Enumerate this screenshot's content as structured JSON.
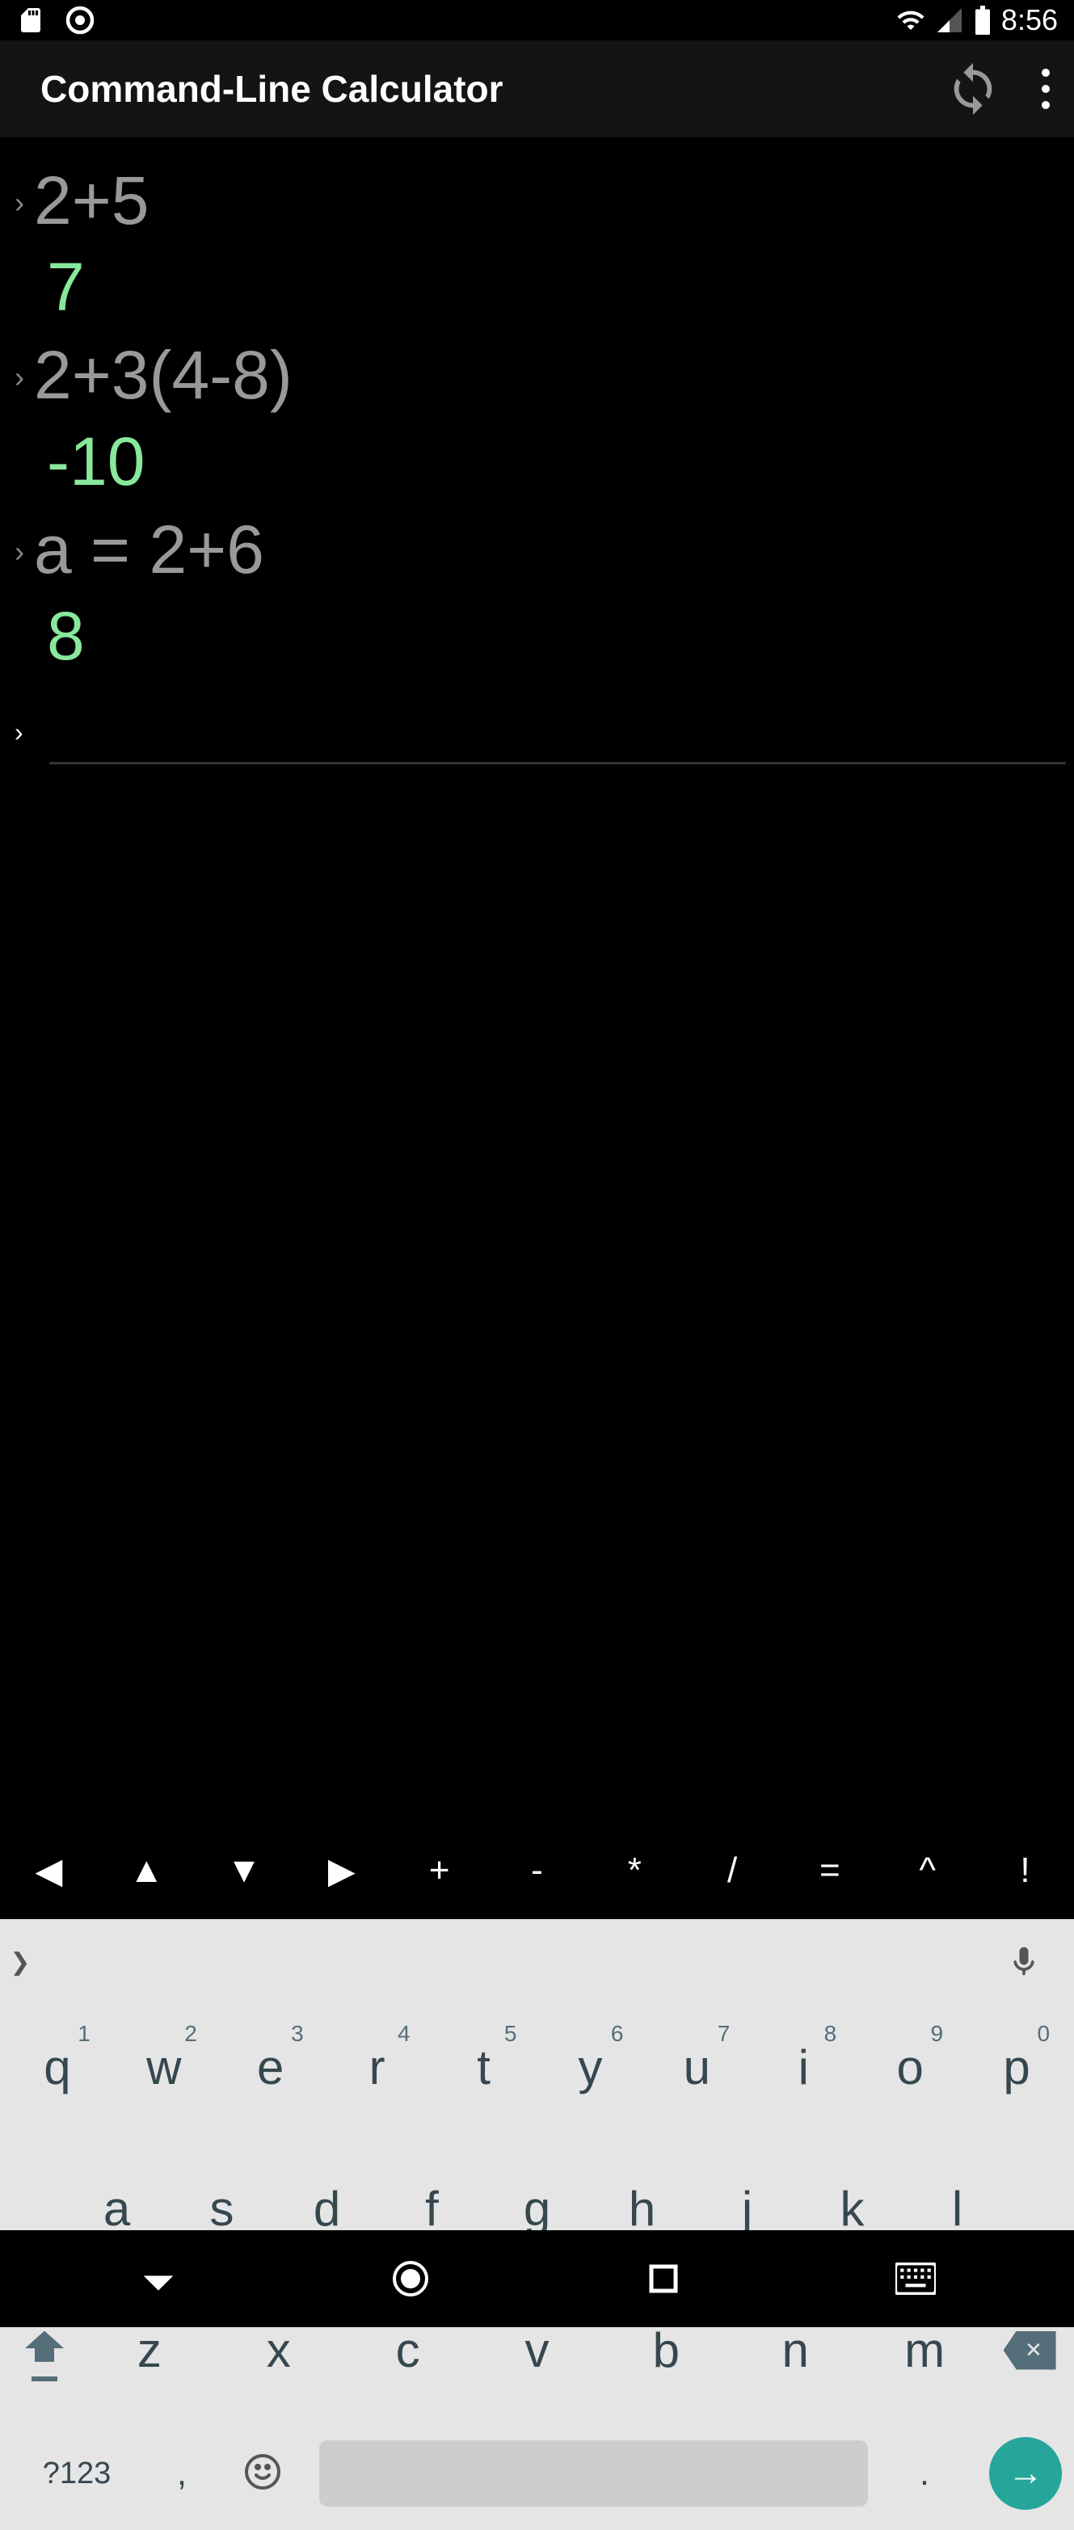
{
  "status": {
    "time": "8:56"
  },
  "app": {
    "title": "Command-Line Calculator"
  },
  "history": [
    {
      "expr": "2+5",
      "result": "7"
    },
    {
      "expr": "2+3(4-8)",
      "result": "-10"
    },
    {
      "expr": "a = 2+6",
      "result": "8"
    }
  ],
  "symbol_keys": [
    "◀",
    "▲",
    "▼",
    "▶",
    "+",
    "-",
    "*",
    "/",
    "=",
    "^",
    "!"
  ],
  "kb": {
    "row1": [
      {
        "k": "q",
        "a": "1"
      },
      {
        "k": "w",
        "a": "2"
      },
      {
        "k": "e",
        "a": "3"
      },
      {
        "k": "r",
        "a": "4"
      },
      {
        "k": "t",
        "a": "5"
      },
      {
        "k": "y",
        "a": "6"
      },
      {
        "k": "u",
        "a": "7"
      },
      {
        "k": "i",
        "a": "8"
      },
      {
        "k": "o",
        "a": "9"
      },
      {
        "k": "p",
        "a": "0"
      }
    ],
    "row2": [
      "a",
      "s",
      "d",
      "f",
      "g",
      "h",
      "j",
      "k",
      "l"
    ],
    "row3": [
      "z",
      "x",
      "c",
      "v",
      "b",
      "n",
      "m"
    ],
    "sym_mode": "?123",
    "comma": ",",
    "period": "."
  }
}
